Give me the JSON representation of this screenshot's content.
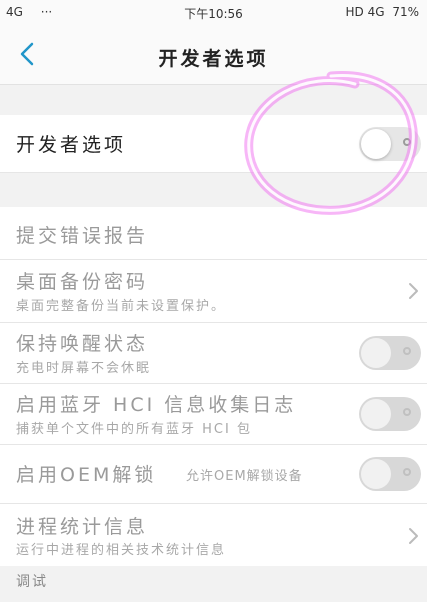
{
  "status_bar": {
    "signal": "4G",
    "menu": "···",
    "time": "下午10:56",
    "network": "HD 4G",
    "battery": "71%"
  },
  "header": {
    "title": "开发者选项"
  },
  "settings": {
    "developer_options": {
      "label": "开发者选项",
      "enabled": false
    },
    "submit_bug_report": {
      "label": "提交错误报告"
    },
    "desktop_backup_password": {
      "label": "桌面备份密码",
      "subtitle": "桌面完整备份当前未设置保护。"
    },
    "stay_awake": {
      "label": "保持唤醒状态",
      "subtitle": "充电时屏幕不会休眠",
      "enabled": false
    },
    "bluetooth_hci_log": {
      "label": "启用蓝牙 HCI 信息收集日志",
      "subtitle": "捕获单个文件中的所有蓝牙 HCI 包",
      "enabled": false
    },
    "oem_unlock": {
      "label": "启用OEM解锁",
      "inline_note": "允许OEM解锁设备",
      "enabled": false
    },
    "process_stats": {
      "label": "进程统计信息",
      "subtitle": "运行中进程的相关技术统计信息"
    }
  },
  "sections": {
    "debugging": "调试"
  },
  "colors": {
    "accent": "#2196c9",
    "annotation": "#ee55ee"
  }
}
